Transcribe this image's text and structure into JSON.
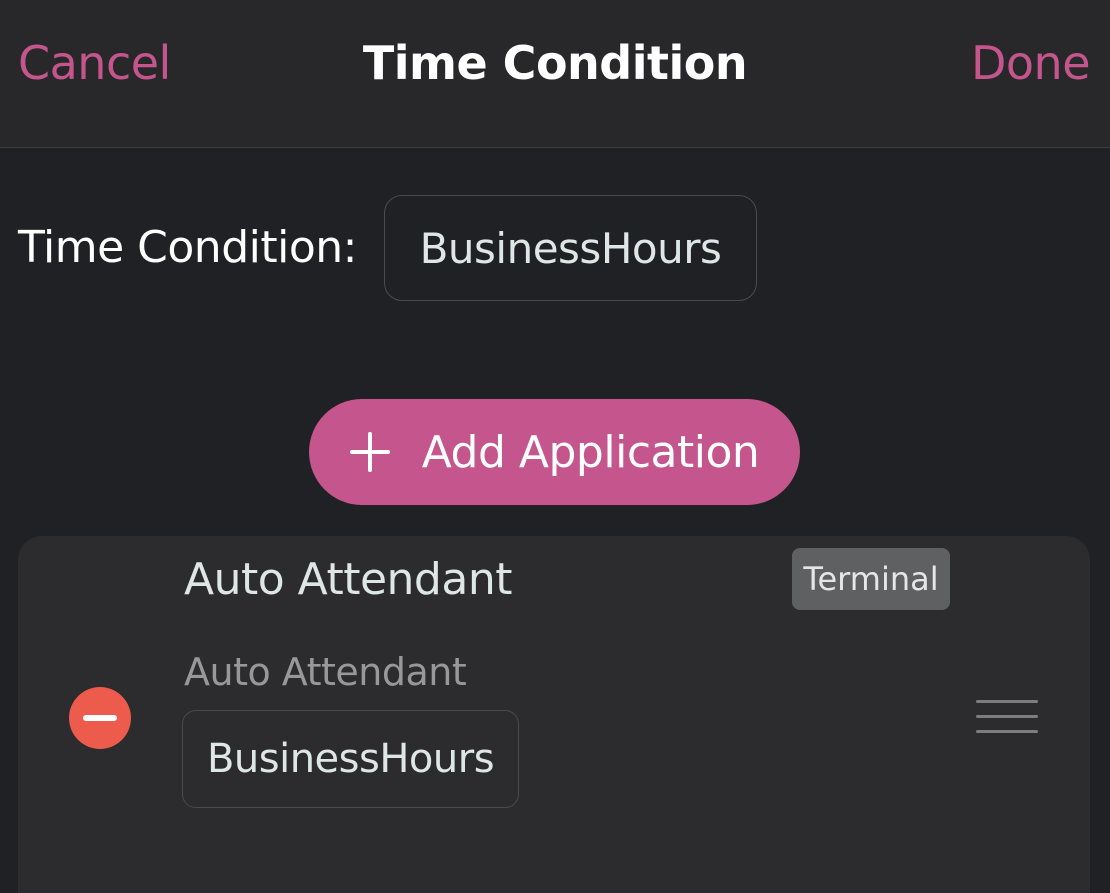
{
  "nav": {
    "cancel_label": "Cancel",
    "title": "Time Condition",
    "done_label": "Done"
  },
  "form": {
    "time_condition_label": "Time Condition:",
    "time_condition_value": "BusinessHours"
  },
  "add_application": {
    "label": "Add Application",
    "icon": "plus-icon"
  },
  "application": {
    "title": "Auto Attendant",
    "badge": "Terminal",
    "subtitle": "Auto Attendant",
    "value": "BusinessHours",
    "remove_icon": "minus-circle-icon",
    "drag_icon": "reorder-handle-icon"
  },
  "colors": {
    "accent": "#c5568d",
    "background": "#202124",
    "card": "#2c2c2e",
    "remove": "#ec5b4b",
    "badge": "#5f6062"
  }
}
